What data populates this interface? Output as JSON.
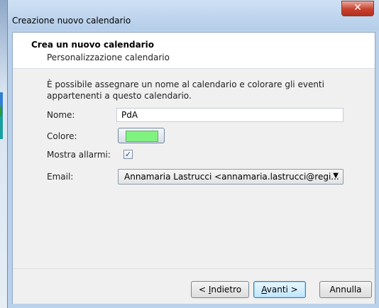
{
  "window": {
    "title": "Creazione nuovo calendario",
    "close_glyph": "✕"
  },
  "header": {
    "title": "Crea un nuovo calendario",
    "subtitle": "Personalizzazione calendario"
  },
  "form": {
    "description": "È possibile assegnare un nome al calendario e colorare gli eventi appartenenti a questo calendario.",
    "name_label": "Nome:",
    "name_value": "PdA",
    "color_label": "Colore:",
    "color_value": "#7ff27f",
    "alarms_label": "Mostra allarmi:",
    "alarms_checked": true,
    "alarms_glyph": "✓",
    "email_label": "Email:",
    "email_value": "Annamaria Lastrucci <annamaria.lastrucci@regi...",
    "email_arrow": "▼"
  },
  "buttons": {
    "back_prefix": "< ",
    "back_accel": "I",
    "back_rest": "ndietro",
    "next_accel": "A",
    "next_rest": "vanti >",
    "cancel": "Annulla"
  }
}
